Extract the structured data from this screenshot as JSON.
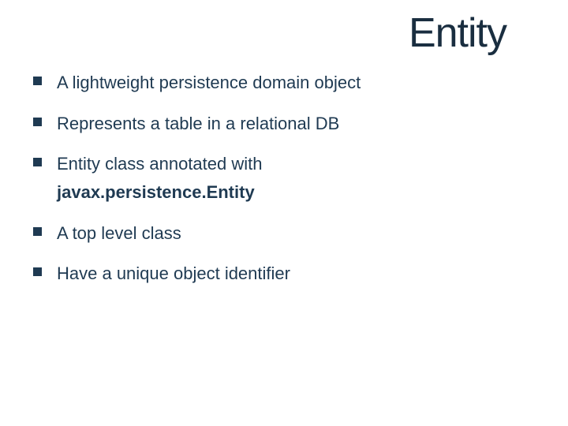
{
  "title": "Entity",
  "bullets": [
    {
      "text": "A lightweight persistence domain object"
    },
    {
      "text": "Represents a table in a relational DB"
    },
    {
      "text": "Entity class annotated with",
      "sub": "javax.persistence.Entity"
    },
    {
      "text": "A top level class"
    },
    {
      "text": "Have a unique object identifier"
    }
  ]
}
